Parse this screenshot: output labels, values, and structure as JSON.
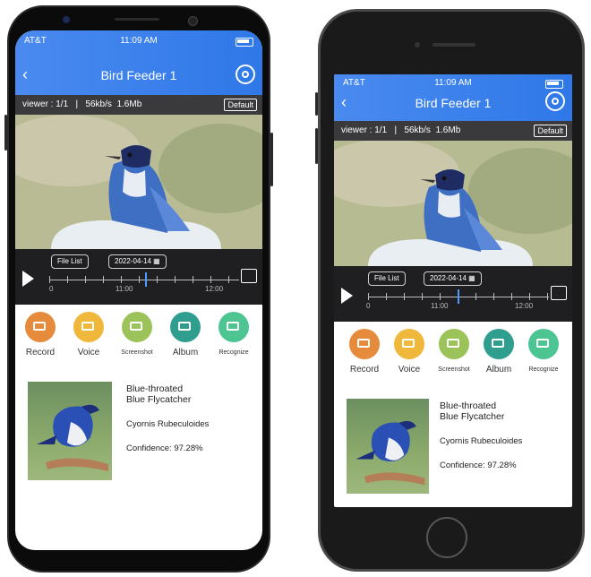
{
  "screens": [
    {
      "status_bar": {
        "carrier": "AT&T",
        "time": "11:09 AM"
      },
      "header": {
        "title": "Bird Feeder 1",
        "back_icon": "chevron-left-icon",
        "settings_icon": "gear-icon"
      },
      "stream_info": {
        "viewer": "viewer : 1/1",
        "separator": "|",
        "bitrate": "56kb/s",
        "size": "1.6Mb",
        "quality_button": "Default"
      },
      "timeline": {
        "file_list": "File List",
        "date": "2022-04-14",
        "labels": [
          "0",
          "11:00",
          "12:00"
        ]
      },
      "actions": [
        {
          "label": "Record",
          "icon": "video-record-icon",
          "color": "#e68a3c"
        },
        {
          "label": "Voice",
          "icon": "speaker-icon",
          "color": "#f0b83a"
        },
        {
          "label": "Screenshot",
          "icon": "screenshot-icon",
          "color": "#9cc25a"
        },
        {
          "label": "Album",
          "icon": "album-icon",
          "color": "#2f9e8e"
        },
        {
          "label": "Recognize",
          "icon": "upload-icon",
          "color": "#4cc592"
        }
      ],
      "result": {
        "name_line1": "Blue-throated",
        "name_line2": "Blue Flycatcher",
        "scientific": "Cyornis Rubeculoides",
        "confidence": "Confidence: 97.28%"
      }
    },
    {
      "status_bar": {
        "carrier": "AT&T",
        "time": "11:09 AM"
      },
      "header": {
        "title": "Bird Feeder 1",
        "back_icon": "chevron-left-icon",
        "settings_icon": "gear-icon"
      },
      "stream_info": {
        "viewer": "viewer : 1/1",
        "separator": "|",
        "bitrate": "56kb/s",
        "size": "1.6Mb",
        "quality_button": "Default"
      },
      "timeline": {
        "file_list": "File List",
        "date": "2022-04-14",
        "labels": [
          "0",
          "11:00",
          "12:00"
        ]
      },
      "actions": [
        {
          "label": "Record",
          "icon": "video-record-icon",
          "color": "#e68a3c"
        },
        {
          "label": "Voice",
          "icon": "speaker-icon",
          "color": "#f0b83a"
        },
        {
          "label": "Screenshot",
          "icon": "screenshot-icon",
          "color": "#9cc25a"
        },
        {
          "label": "Album",
          "icon": "album-icon",
          "color": "#2f9e8e"
        },
        {
          "label": "Recognize",
          "icon": "upload-icon",
          "color": "#4cc592"
        }
      ],
      "result": {
        "name_line1": "Blue-throated",
        "name_line2": "Blue Flycatcher",
        "scientific": "Cyornis Rubeculoides",
        "confidence": "Confidence: 97.28%"
      }
    }
  ],
  "colors": {
    "header_gradient_start": "#4a8af0",
    "header_gradient_end": "#2f78e8",
    "info_bar": "#3a3a3c",
    "timeline_bg": "#1f1f21",
    "cursor": "#4a9bff"
  }
}
